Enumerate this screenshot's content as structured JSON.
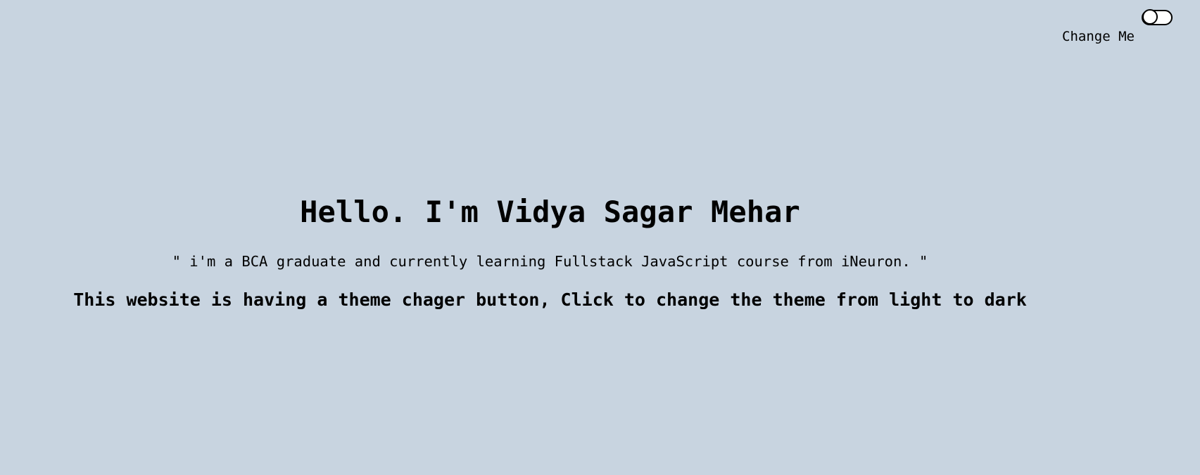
{
  "theme_toggle": {
    "label": "Change Me",
    "checked": false
  },
  "hero": {
    "title": "Hello. I'm Vidya Sagar Mehar",
    "subtitle": "\" i'm a BCA graduate and currently learning Fullstack JavaScript course from iNeuron. \"",
    "note": "This website is having a theme chager button, Click to change the theme from light to dark"
  },
  "colors": {
    "background": "#c8d4e0",
    "text": "#000000",
    "toggle_fill": "#ffffff"
  }
}
